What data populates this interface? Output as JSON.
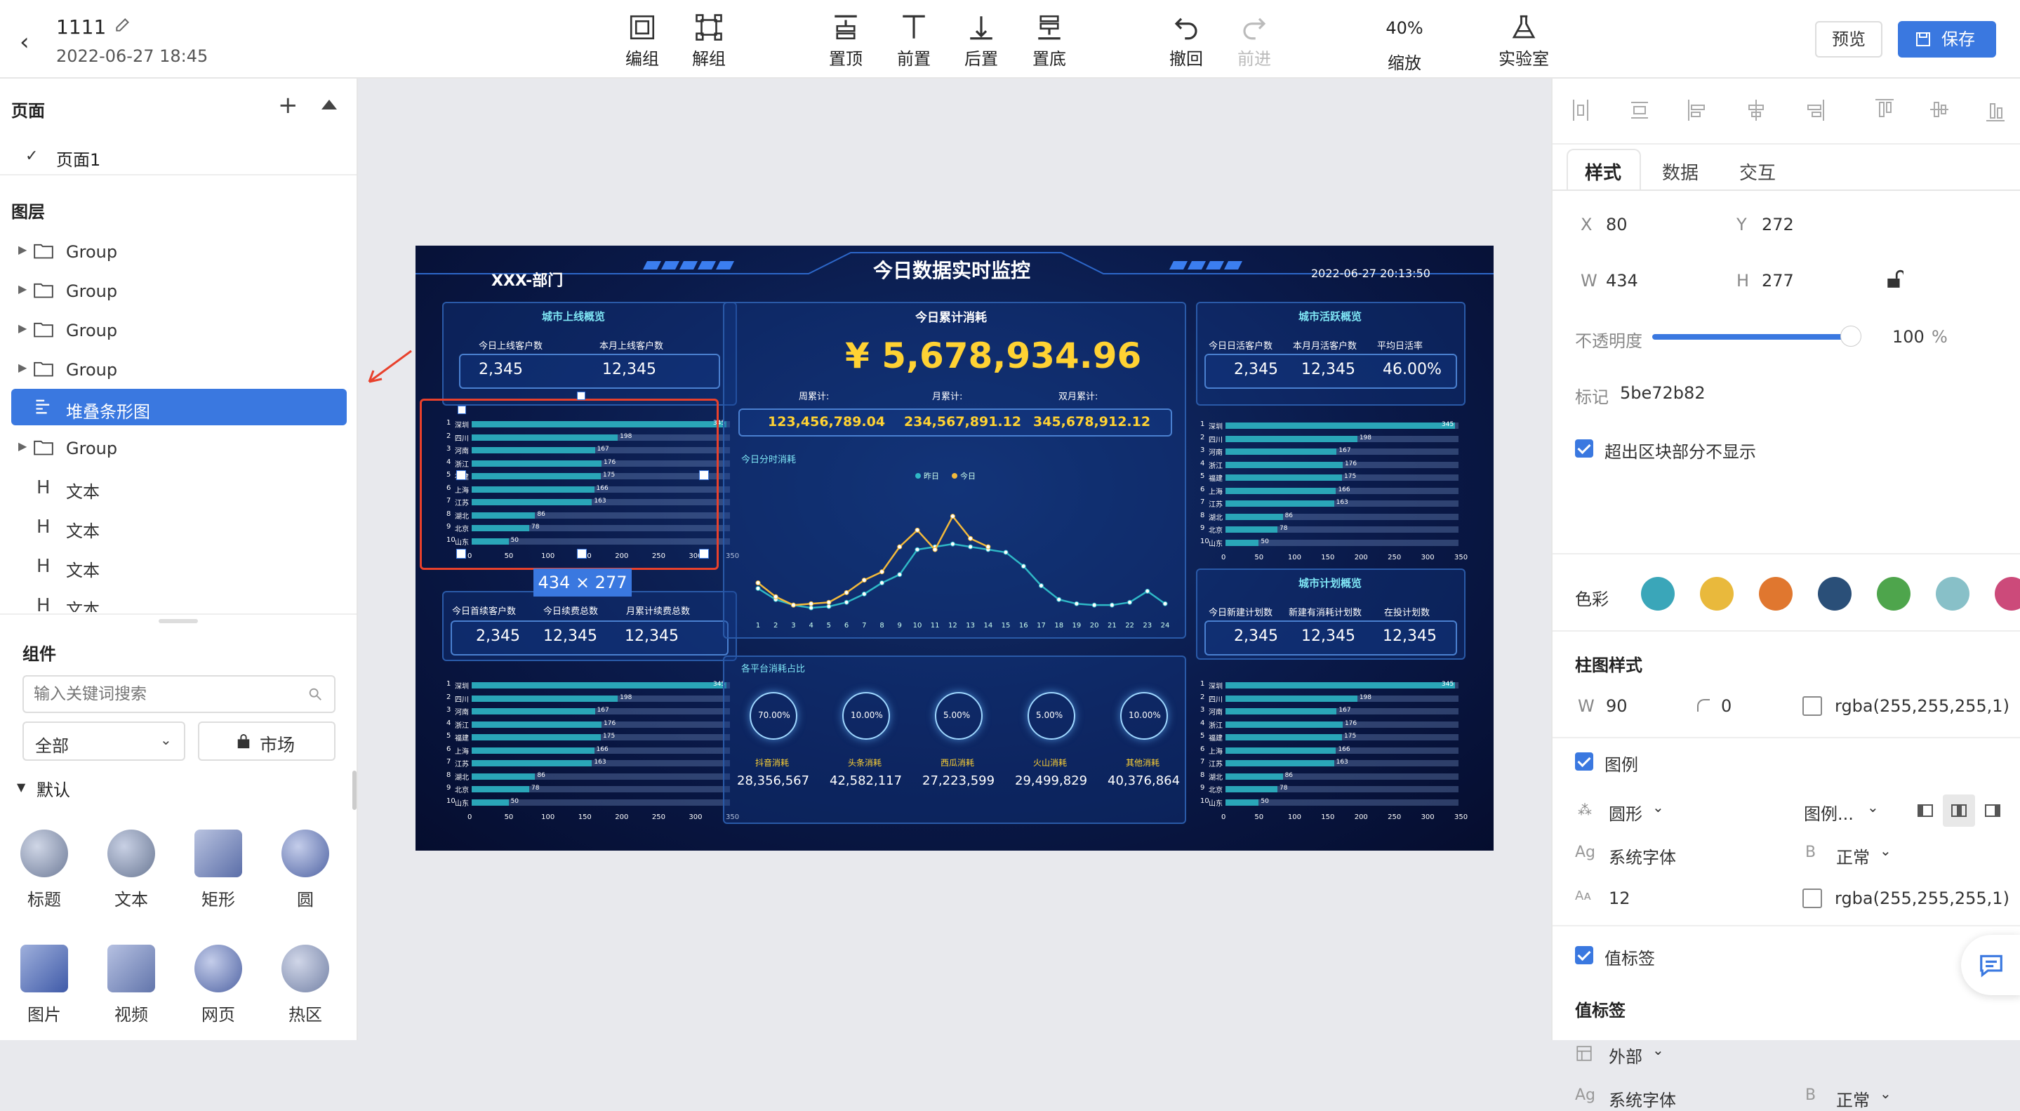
{
  "header": {
    "title": "1111",
    "date": "2022-06-27 18:45",
    "tools": [
      {
        "id": "group",
        "label": "编组",
        "disabled": false
      },
      {
        "id": "ungroup",
        "label": "解组",
        "disabled": false
      },
      {
        "id": "top",
        "label": "置顶",
        "disabled": false
      },
      {
        "id": "forward",
        "label": "前置",
        "disabled": false
      },
      {
        "id": "backward",
        "label": "后置",
        "disabled": false
      },
      {
        "id": "bottom",
        "label": "置底",
        "disabled": false
      },
      {
        "id": "undo",
        "label": "撤回",
        "disabled": false
      },
      {
        "id": "redo",
        "label": "前进",
        "disabled": true
      }
    ],
    "zoom_value": "40%",
    "zoom_label": "缩放",
    "lab_label": "实验室",
    "preview_label": "预览",
    "save_label": "保存"
  },
  "left": {
    "pages_title": "页面",
    "pages": [
      "页面1"
    ],
    "layers_title": "图层",
    "layers": [
      {
        "type": "group",
        "label": "Group"
      },
      {
        "type": "group",
        "label": "Group"
      },
      {
        "type": "group",
        "label": "Group"
      },
      {
        "type": "group",
        "label": "Group"
      },
      {
        "type": "chart",
        "label": "堆叠条形图",
        "selected": true
      },
      {
        "type": "group",
        "label": "Group"
      },
      {
        "type": "text",
        "label": "文本"
      },
      {
        "type": "text",
        "label": "文本"
      },
      {
        "type": "text",
        "label": "文本"
      },
      {
        "type": "text",
        "label": "文本"
      }
    ],
    "components_title": "组件",
    "search_placeholder": "输入关键词搜索",
    "filter_value": "全部",
    "market_label": "市场",
    "default_group": "默认",
    "components": [
      "标题",
      "文本",
      "矩形",
      "圆",
      "图片",
      "视频",
      "网页",
      "热区"
    ]
  },
  "canvas": {
    "selection_size": "434 × 277",
    "dashboard": {
      "dept": "XXX-部门",
      "title": "今日数据实时监控",
      "datetime": "2022-06-27 20:13:50",
      "left_top_title": "城市上线概览",
      "left_top_labels": [
        "今日上线客户数",
        "本月上线客户数"
      ],
      "left_top_values": [
        "2,345",
        "12,345"
      ],
      "left_bottom_labels": [
        "今日首续客户数",
        "今日续费总数",
        "月累计续费总数"
      ],
      "left_bottom_values": [
        "2,345",
        "12,345",
        "12,345"
      ],
      "center_title": "今日累计消耗",
      "big_number": "¥ 5,678,934.96",
      "period_labels": [
        "周累计:",
        "月累计:",
        "双月累计:"
      ],
      "period_values": [
        "123,456,789.04",
        "234,567,891.12",
        "345,678,912.12"
      ],
      "line_title": "今日分时消耗",
      "legend": [
        "昨日",
        "今日"
      ],
      "platform_title": "各平台消耗占比",
      "platforms": [
        {
          "pct": "70.00%",
          "name": "抖音消耗",
          "value": "28,356,567"
        },
        {
          "pct": "10.00%",
          "name": "头条消耗",
          "value": "42,582,117"
        },
        {
          "pct": "5.00%",
          "name": "西瓜消耗",
          "value": "27,223,599"
        },
        {
          "pct": "5.00%",
          "name": "火山消耗",
          "value": "29,499,829"
        },
        {
          "pct": "10.00%",
          "name": "其他消耗",
          "value": "40,376,864"
        }
      ],
      "right_top_title": "城市活跃概览",
      "right_top_labels": [
        "今日日活客户数",
        "本月月活客户数",
        "平均日活率"
      ],
      "right_top_values": [
        "2,345",
        "12,345",
        "46.00%"
      ],
      "right_bottom_title": "城市计划概览",
      "right_bottom_labels": [
        "今日新建计划数",
        "新建有消耗计划数",
        "在投计划数"
      ],
      "right_bottom_values": [
        "2,345",
        "12,345",
        "12,345"
      ],
      "cities": [
        "深圳",
        "四川",
        "河南",
        "浙江",
        "福建",
        "上海",
        "江苏",
        "湖北",
        "北京",
        "山东"
      ],
      "city_values": [
        345,
        198,
        167,
        176,
        175,
        166,
        163,
        86,
        78,
        50
      ],
      "bar_axis": [
        "0",
        "50",
        "100",
        "150",
        "200",
        "250",
        "300",
        "350"
      ],
      "hours": [
        "1",
        "2",
        "3",
        "4",
        "5",
        "6",
        "7",
        "8",
        "9",
        "10",
        "11",
        "12",
        "13",
        "14",
        "15",
        "16",
        "17",
        "18",
        "19",
        "20",
        "21",
        "22",
        "23",
        "24"
      ],
      "yesterday": [
        100,
        60,
        40,
        30,
        35,
        50,
        80,
        120,
        150,
        240,
        250,
        260,
        250,
        240,
        230,
        180,
        110,
        60,
        45,
        40,
        40,
        50,
        90,
        45
      ],
      "today": [
        120,
        70,
        40,
        45,
        50,
        85,
        130,
        160,
        250,
        310,
        240,
        360,
        280,
        250
      ]
    }
  },
  "right": {
    "tabs": [
      "样式",
      "数据",
      "交互"
    ],
    "x_label": "X",
    "x_value": "80",
    "y_label": "Y",
    "y_value": "272",
    "w_label": "W",
    "w_value": "434",
    "h_label": "H",
    "h_value": "277",
    "opacity_label": "不透明度",
    "opacity_value": "100",
    "opacity_unit": "%",
    "mark_label": "标记",
    "mark_value": "5be72b82",
    "overflow_label": "超出区块部分不显示",
    "color_label": "色彩",
    "colors": [
      "#3aa6b9",
      "#e9b93c",
      "#e0772f",
      "#2a4f78",
      "#4ea54c",
      "#88c0c8",
      "#cc4a7a",
      "#e88aa6"
    ],
    "bar_style_title": "柱图样式",
    "bar_w_label": "W",
    "bar_w_value": "90",
    "bar_radius_value": "0",
    "bar_color": "rgba(255,255,255,1)",
    "legend_label": "图例",
    "legend_shape": "圆形",
    "legend_pos": "图例...",
    "font_label": "系统字体",
    "weight_label": "正常",
    "font_size": "12",
    "font_color": "rgba(255,255,255,1)",
    "value_label_label": "值标签",
    "value_label_title": "值标签",
    "value_label_pos": "外部",
    "value_font": "系统字体",
    "value_weight": "正常"
  }
}
